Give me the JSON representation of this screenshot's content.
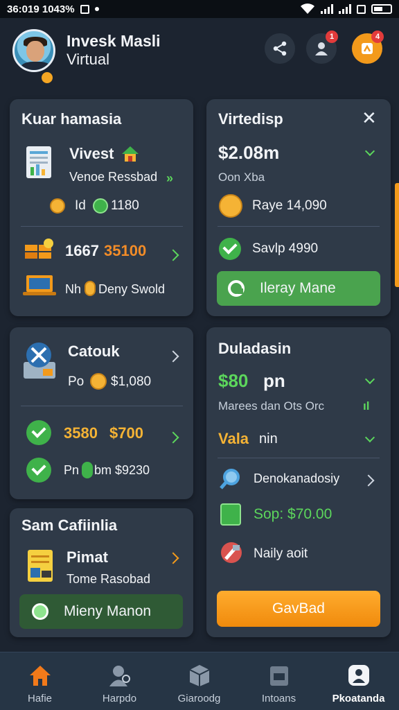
{
  "status_bar": {
    "time": "36:019 1043%"
  },
  "header": {
    "user_name": "Invesk Masli",
    "user_sub": "Virtual",
    "bell_badge": "1",
    "orange_badge": "4"
  },
  "card_left_1": {
    "title": "Kuar hamasia",
    "item1_title": "Vivest",
    "item1_sub": "Venoe Ressbad",
    "item1_meta_a": "Id",
    "item1_meta_b": "1180",
    "item2_value_a": "1667",
    "item2_value_b": "35100",
    "item3_text_a": "Nh",
    "item3_text_b": "Deny Swold"
  },
  "card_right_1": {
    "title": "Virtedisp",
    "amount": "$2.08m",
    "amount_sub": "Oon Xba",
    "row1": "Raye 14,090",
    "row2": "Savlp 4990",
    "button": "Ileray Mane"
  },
  "card_left_2": {
    "title": "Catouk",
    "row1_a": "Po",
    "row1_b": "$1,080",
    "row2_a": "3580",
    "row2_b": "$700",
    "row3_a": "Pn",
    "row3_b": "bm $9230"
  },
  "card_right_2": {
    "title": "Duladasin",
    "amount": "$80",
    "amount_unit": "pn",
    "sub": "Marees dan Ots Orc",
    "vala_a": "Vala",
    "vala_b": "nin",
    "row1": "Denokanadosiy",
    "row2": "Sop: $70.00",
    "row3": "Naily aoit",
    "button": "GavBad"
  },
  "card_left_3": {
    "title": "Sam Cafiinlia",
    "item_title": "Pimat",
    "item_sub": "Tome Rasobad",
    "button": "Mieny Manon"
  },
  "tabs": [
    {
      "label": "Hafie"
    },
    {
      "label": "Harpdo"
    },
    {
      "label": "Giaroodg"
    },
    {
      "label": "Intoans"
    },
    {
      "label": "Pkoatanda"
    }
  ],
  "colors": {
    "background": "#1c2430",
    "card": "#2f3a48",
    "accent_orange": "#f39a1b",
    "accent_green": "#4aa34e",
    "gold_text": "#f5b335"
  }
}
